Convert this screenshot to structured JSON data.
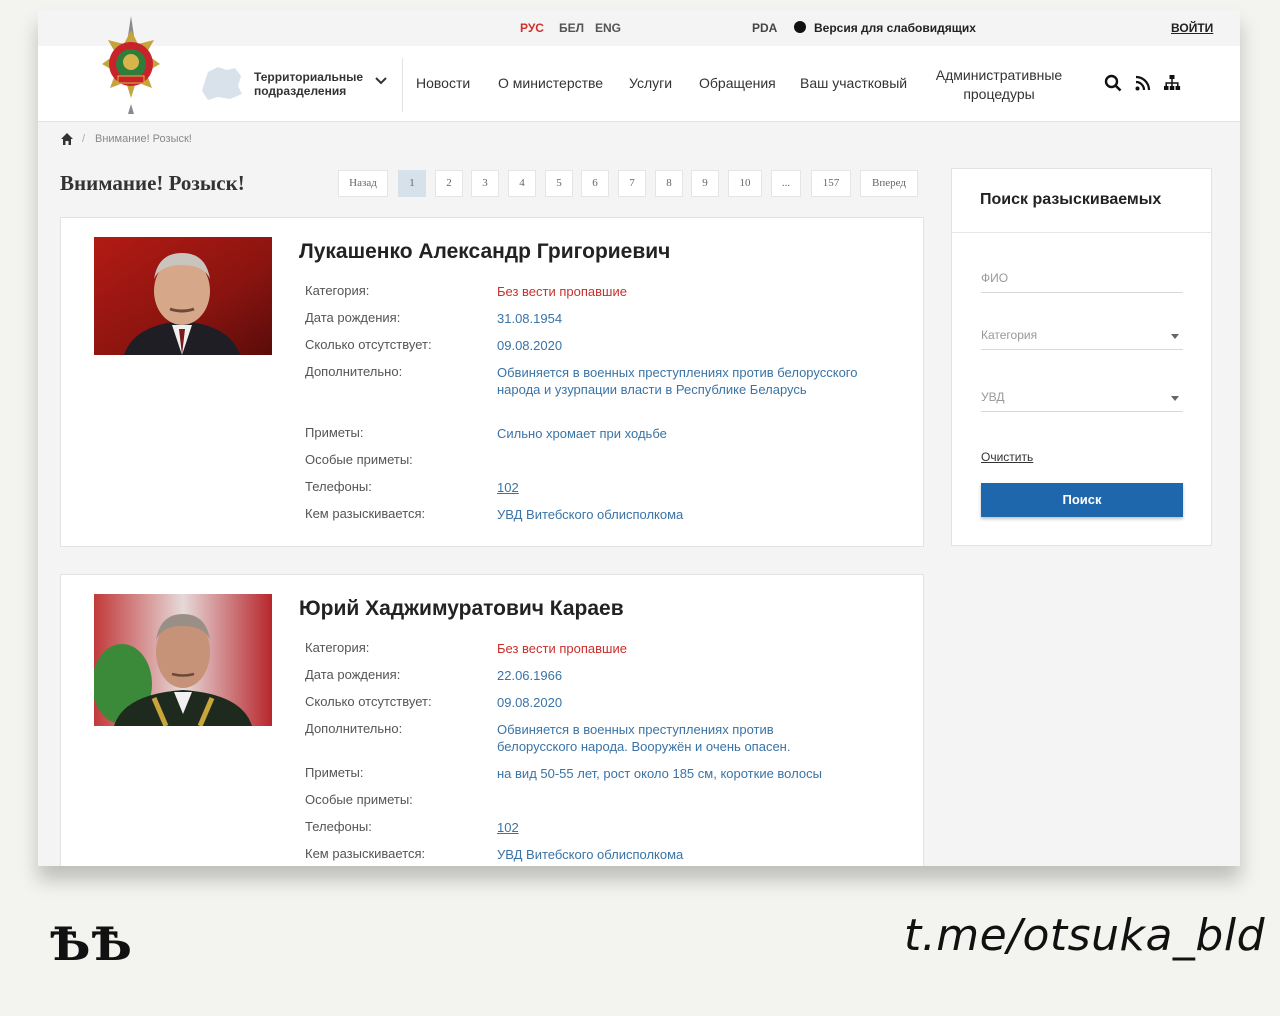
{
  "topbar": {
    "languages": [
      "РУС",
      "БЕЛ",
      "ENG"
    ],
    "pda": "PDA",
    "vision_version": "Версия для слабовидящих",
    "login": "ВОЙТИ"
  },
  "header": {
    "territorial": "Территориальные подразделения",
    "nav": [
      "Новости",
      "О министерстве",
      "Услуги",
      "Обращения",
      "Ваш участковый",
      "Административные процедуры"
    ],
    "icons": [
      "search-icon",
      "rss-icon",
      "sitemap-icon"
    ]
  },
  "breadcrumb": {
    "current": "Внимание! Розыск!"
  },
  "page_title": "Внимание! Розыск!",
  "pagination": [
    "Назад",
    "1",
    "2",
    "3",
    "4",
    "5",
    "6",
    "7",
    "8",
    "9",
    "10",
    "...",
    "157",
    "Вперед"
  ],
  "labels": {
    "category": "Категория:",
    "birth": "Дата рождения:",
    "absent": "Сколько отсутствует:",
    "extra": "Дополнительно:",
    "signs": "Приметы:",
    "special": "Особые приметы:",
    "phones": "Телефоны:",
    "wanted_by": "Кем разыскивается:"
  },
  "persons": [
    {
      "name": "Лукашенко Александр Григориевич",
      "category": "Без вести пропавшие",
      "birth": "31.08.1954",
      "absent": "09.08.2020",
      "extra": "Обвиняется в военных преступлениях против белорусского народа и узурпации власти в Республике Беларусь",
      "signs": "Сильно хромает при ходьбе",
      "phones": "102",
      "wanted_by": "УВД Витебского облисполкома"
    },
    {
      "name": "Юрий Хаджимуратович Караев",
      "category": "Без вести пропавшие",
      "birth": "22.06.1966",
      "absent": "09.08.2020",
      "extra": "Обвиняется в военных преступлениях против белорусского народа. Вооружён и очень опасен.",
      "signs": "на вид 50-55 лет, рост около 185 см, короткие волосы",
      "phones": "102",
      "wanted_by": "УВД Витебского облисполкома"
    }
  ],
  "search_panel": {
    "title": "Поиск разыскиваемых",
    "fio_placeholder": "ФИО",
    "category_placeholder": "Категория",
    "uvd_placeholder": "УВД",
    "clear": "Очистить",
    "button": "Поиск"
  },
  "watermark": {
    "left": "ѢѢ",
    "right": "t.me/otsuka_bld"
  },
  "colors": {
    "accent_red": "#c9302c",
    "link_blue": "#3a73a6",
    "button_blue": "#1f67ad"
  }
}
